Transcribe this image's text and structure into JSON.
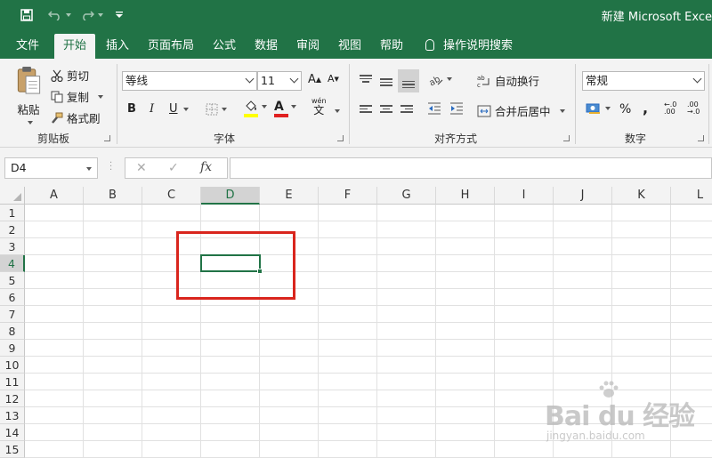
{
  "titlebar": {
    "title": "新建 Microsoft Exce",
    "save_icon": "save-icon",
    "undo_icon": "undo-icon",
    "redo_icon": "redo-icon",
    "customize_icon": "customize-qat-icon"
  },
  "tabs": [
    "文件",
    "开始",
    "插入",
    "页面布局",
    "公式",
    "数据",
    "审阅",
    "视图",
    "帮助"
  ],
  "active_tab": "开始",
  "tell_me": "操作说明搜索",
  "ribbon": {
    "clipboard": {
      "paste": "粘贴",
      "cut": "剪切",
      "copy": "复制",
      "format_painter": "格式刷",
      "label": "剪贴板"
    },
    "font": {
      "font_name": "等线",
      "font_size": "11",
      "bold": "B",
      "italic": "I",
      "underline": "U",
      "grow": "A",
      "shrink": "A",
      "phonetic_top": "wén",
      "phonetic_char": "文",
      "label": "字体"
    },
    "alignment": {
      "wrap_text": "自动换行",
      "merge_center": "合并后居中",
      "label": "对齐方式"
    },
    "number": {
      "format": "常规",
      "percent": "%",
      "comma": ",",
      "label": "数字"
    }
  },
  "formula_bar": {
    "name_box": "D4",
    "cancel": "✕",
    "enter": "✓",
    "fx": "fx",
    "value": ""
  },
  "sheet": {
    "columns": [
      "A",
      "B",
      "C",
      "D",
      "E",
      "F",
      "G",
      "H",
      "I",
      "J",
      "K",
      "L"
    ],
    "rows": [
      "1",
      "2",
      "3",
      "4",
      "5",
      "6",
      "7",
      "8",
      "9",
      "10",
      "11",
      "12",
      "13",
      "14",
      "15"
    ],
    "selected_column": "D",
    "selected_row": "4"
  },
  "watermark": {
    "brand": "Bai du 经验",
    "url": "jingyan.baidu.com"
  },
  "colors": {
    "excel_green": "#217346",
    "annotation_red": "#d9251d"
  }
}
